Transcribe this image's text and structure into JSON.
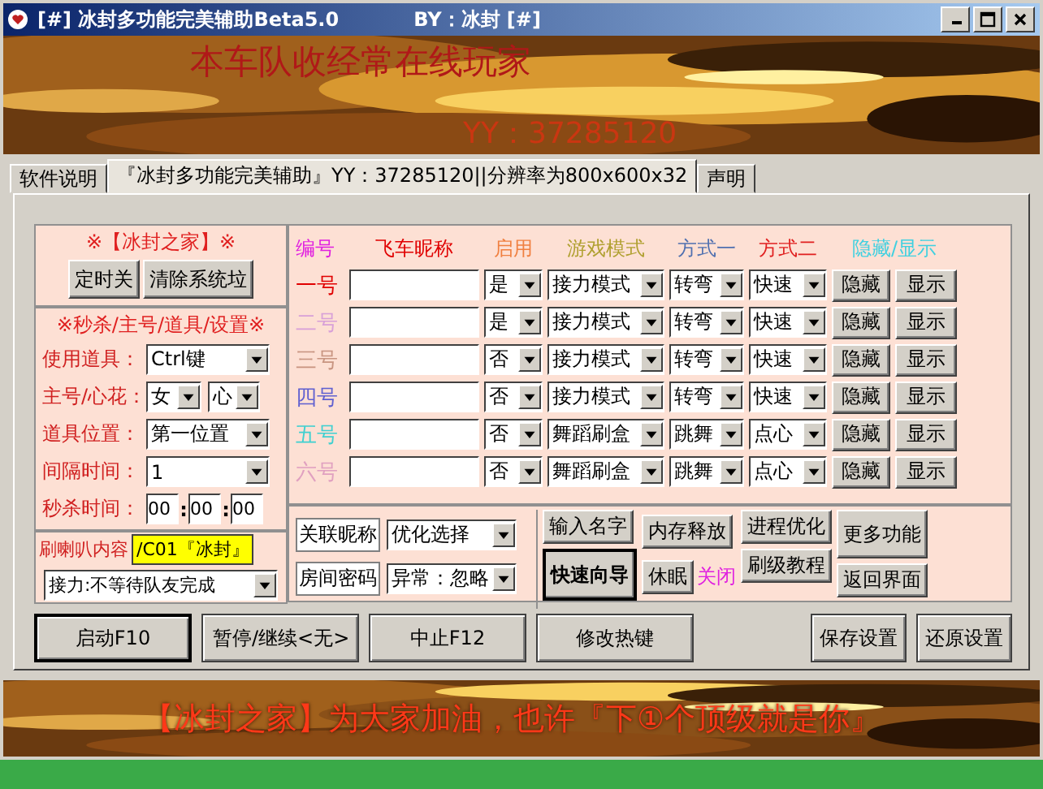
{
  "window": {
    "title": "[#] 冰封多功能完美辅助Beta5.0",
    "author": "BY：冰封 [#]"
  },
  "banner_top": {
    "kind": "picture",
    "headline": "本车队收经常在线玩家",
    "contact": "YY：37285120"
  },
  "tabs": [
    {
      "label": "软件说明",
      "selected": false
    },
    {
      "label": "『冰封多功能完美辅助』YY：37285120||分辨率为800x600x32",
      "selected": true
    },
    {
      "label": "声明",
      "selected": false
    }
  ],
  "tools_box": {
    "title": "※【冰封之家】※",
    "buttons": [
      "定时关",
      "清除系统垃"
    ]
  },
  "settings_box": {
    "title": "※秒杀/主号/道具/设置※",
    "item": {
      "label": "使用道具：",
      "value": "Ctrl键"
    },
    "main": {
      "label": "主号/心花：",
      "gender": "女",
      "flower": "心"
    },
    "position": {
      "label": "道具位置：",
      "value": "第一位置"
    },
    "interval": {
      "label": "间隔时间：",
      "value": "1"
    },
    "kill_time": {
      "label": "秒杀时间：",
      "hours": "00",
      "minutes": "00",
      "seconds": "00",
      "separators": [
        ":",
        ":"
      ]
    }
  },
  "horn": {
    "label": "刷喇叭内容",
    "value": "/C01『冰封』",
    "relay": "接力:不等待队友完成"
  },
  "players": {
    "columns": [
      {
        "label": "编号",
        "color": "#e020e0"
      },
      {
        "label": "飞车昵称",
        "color": "#e00000"
      },
      {
        "label": "启用",
        "color": "#f08040"
      },
      {
        "label": "游戏模式",
        "color": "#b0a030"
      },
      {
        "label": "方式一",
        "color": "#5070b0"
      },
      {
        "label": "方式二",
        "color": "#e02020"
      },
      {
        "label": "隐藏/显示",
        "color": "#40d0e0"
      }
    ],
    "rows": [
      {
        "number": "一号",
        "color": "#e00000",
        "enabled": "是",
        "mode": "接力模式",
        "way1": "转弯",
        "way2": "快速",
        "hide": "隐藏",
        "show": "显示"
      },
      {
        "number": "二号",
        "color": "#d8a0d8",
        "enabled": "是",
        "mode": "接力模式",
        "way1": "转弯",
        "way2": "快速",
        "hide": "隐藏",
        "show": "显示"
      },
      {
        "number": "三号",
        "color": "#c89480",
        "enabled": "否",
        "mode": "接力模式",
        "way1": "转弯",
        "way2": "快速",
        "hide": "隐藏",
        "show": "显示"
      },
      {
        "number": "四号",
        "color": "#6060d0",
        "enabled": "否",
        "mode": "接力模式",
        "way1": "转弯",
        "way2": "快速",
        "hide": "隐藏",
        "show": "显示"
      },
      {
        "number": "五号",
        "color": "#40d0d0",
        "enabled": "否",
        "mode": "舞蹈刷盒",
        "way1": "跳舞",
        "way2": "点心",
        "hide": "隐藏",
        "show": "显示"
      },
      {
        "number": "六号",
        "color": "#e0a0c0",
        "enabled": "否",
        "mode": "舞蹈刷盒",
        "way1": "跳舞",
        "way2": "点心",
        "hide": "隐藏",
        "show": "显示"
      }
    ]
  },
  "link_fields": [
    {
      "label": "关联昵称",
      "value": "优化选择"
    },
    {
      "label": "房间密码",
      "value": "异常：忽略"
    }
  ],
  "actions": {
    "input_name": "输入名字",
    "wizard": "快速向导",
    "memory": "内存释放",
    "sleep": "休眠",
    "sleep_state": "关闭",
    "process": "进程优化",
    "tutorial": "刷级教程",
    "more": "更多功能",
    "back": "返回界面"
  },
  "bottom_buttons": [
    {
      "label": "启动F10",
      "default": true
    },
    {
      "label": "暂停/继续<无>",
      "default": false
    },
    {
      "label": "中止F12",
      "default": false
    },
    {
      "label": "修改热键",
      "default": false
    },
    {
      "label": "保存设置",
      "default": false
    },
    {
      "label": "还原设置",
      "default": false
    }
  ],
  "banner_bottom": {
    "kind": "picture",
    "slogan": "【冰封之家】为大家加油，也许『下①个顶级就是你』"
  }
}
